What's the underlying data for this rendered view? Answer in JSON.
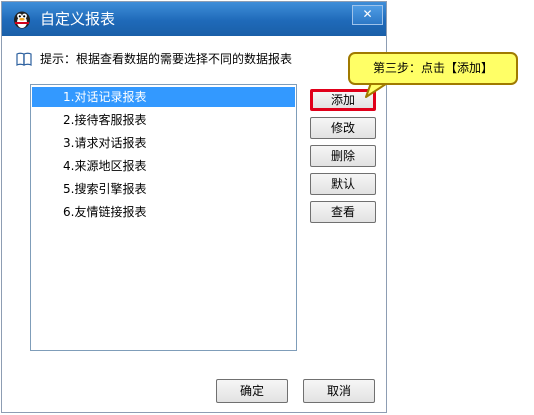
{
  "window": {
    "title": "自定义报表",
    "close_glyph": "✕"
  },
  "hint": {
    "text": "提示：根据查看数据的需要选择不同的数据报表"
  },
  "reports": [
    {
      "label": "1.对话记录报表",
      "selected": true
    },
    {
      "label": "2.接待客服报表",
      "selected": false
    },
    {
      "label": "3.请求对话报表",
      "selected": false
    },
    {
      "label": "4.来源地区报表",
      "selected": false
    },
    {
      "label": "5.搜索引擎报表",
      "selected": false
    },
    {
      "label": "6.友情链接报表",
      "selected": false
    }
  ],
  "actions": {
    "add": "添加",
    "edit": "修改",
    "delete": "删除",
    "default": "默认",
    "view": "查看"
  },
  "footer": {
    "ok": "确定",
    "cancel": "取消"
  },
  "callout": {
    "text": "第三步：点击【添加】"
  },
  "colors": {
    "title_bar": "#1f6ab9",
    "selection": "#3399ff",
    "highlight_border": "#e0001a",
    "callout_fill": "#ffff66"
  }
}
